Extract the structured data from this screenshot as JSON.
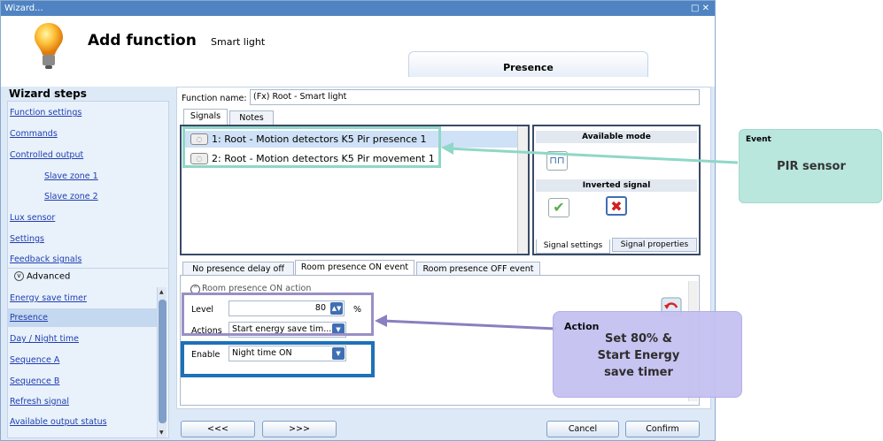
{
  "window": {
    "title": "Wizard...",
    "controls": "□ ✕"
  },
  "header": {
    "title": "Add function",
    "subtitle": "Smart light",
    "tab": "Presence"
  },
  "wizard": {
    "title": "Wizard steps",
    "steps": [
      {
        "label": "Function settings",
        "sub": false
      },
      {
        "label": "Commands",
        "sub": false
      },
      {
        "label": "Controlled output",
        "sub": false
      },
      {
        "label": "Slave zone 1",
        "sub": true
      },
      {
        "label": "Slave zone 2",
        "sub": true
      },
      {
        "label": "Lux sensor",
        "sub": false
      },
      {
        "label": "Settings",
        "sub": false
      },
      {
        "label": "Feedback signals",
        "sub": false
      }
    ],
    "advanced_label": "Advanced",
    "adv_steps": [
      "Energy save timer",
      "Presence",
      "Day / Night time",
      "Sequence A",
      "Sequence B",
      "Refresh signal",
      "Available output status"
    ],
    "active_step": "Presence"
  },
  "function_name": {
    "label": "Function name:",
    "value": "(Fx) Root - Smart light"
  },
  "tabs": {
    "signals": "Signals",
    "notes": "Notes"
  },
  "signals": [
    "1: Root - Motion detectors K5 Pir presence 1",
    "2: Root - Motion detectors K5 Pir movement 1"
  ],
  "signal_settings": {
    "available_mode": "Available mode",
    "inverted_signal": "Inverted signal",
    "tab_settings": "Signal settings",
    "tab_properties": "Signal properties",
    "check": "✔",
    "cross": "✖",
    "mode_icon": "⊓⊓"
  },
  "event_tabs": [
    "No presence delay off",
    "Room presence ON event",
    "Room presence OFF event"
  ],
  "room_on": {
    "section": "Room presence ON action",
    "level_label": "Level",
    "level_value": "80",
    "level_unit": "%",
    "actions_label": "Actions",
    "actions_value": "Start energy save tim...",
    "enable_label": "Enable",
    "enable_value": "Night time ON"
  },
  "nav": {
    "prev": "<<<",
    "next": ">>>",
    "cancel": "Cancel",
    "confirm": "Confirm"
  },
  "callouts": {
    "pir": {
      "caption": "Event",
      "text": "PIR sensor"
    },
    "action": {
      "caption": "Action",
      "lines": [
        "Set 80% &",
        "Start Energy",
        "save timer"
      ]
    }
  },
  "colors": {
    "green_hl": "#8fd7c7",
    "purple_hl": "#9a8fc4",
    "blue_hl": "#1d71b8",
    "link": "#1f3fb0",
    "titlebar": "#4f83c2"
  }
}
